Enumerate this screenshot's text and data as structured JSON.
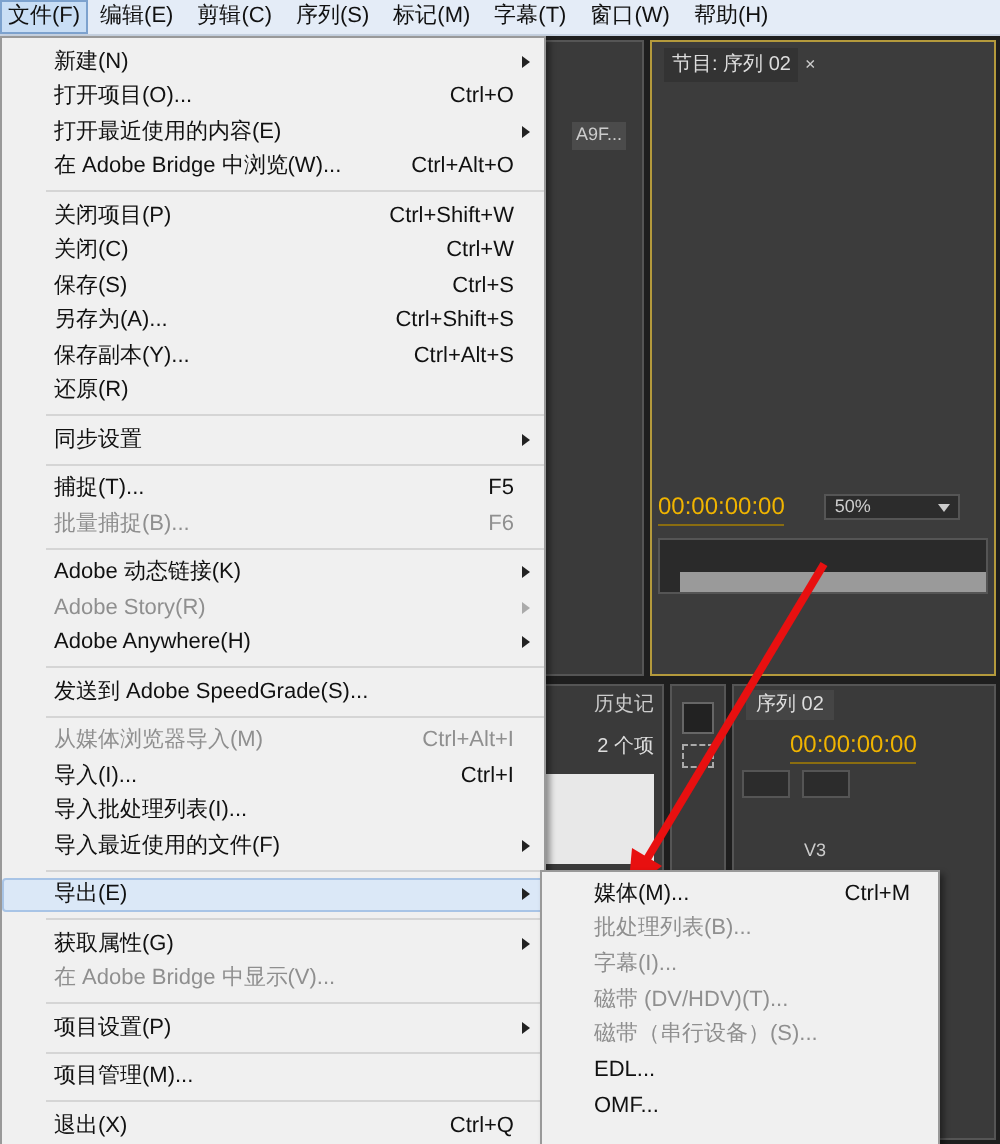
{
  "menubar": [
    {
      "label": "文件(F)",
      "selected": true
    },
    {
      "label": "编辑(E)",
      "selected": false
    },
    {
      "label": "剪辑(C)",
      "selected": false
    },
    {
      "label": "序列(S)",
      "selected": false
    },
    {
      "label": "标记(M)",
      "selected": false
    },
    {
      "label": "字幕(T)",
      "selected": false
    },
    {
      "label": "窗口(W)",
      "selected": false
    },
    {
      "label": "帮助(H)",
      "selected": false
    }
  ],
  "file_menu": [
    {
      "kind": "item",
      "label": "新建(N)",
      "submenu": true,
      "disabled": false,
      "highlighted": false
    },
    {
      "kind": "item",
      "label": "打开项目(O)...",
      "shortcut": "Ctrl+O",
      "disabled": false,
      "highlighted": false
    },
    {
      "kind": "item",
      "label": "打开最近使用的内容(E)",
      "submenu": true,
      "disabled": false,
      "highlighted": false
    },
    {
      "kind": "item",
      "label": "在 Adobe Bridge 中浏览(W)...",
      "shortcut": "Ctrl+Alt+O",
      "disabled": false,
      "highlighted": false
    },
    {
      "kind": "separator"
    },
    {
      "kind": "item",
      "label": "关闭项目(P)",
      "shortcut": "Ctrl+Shift+W",
      "disabled": false,
      "highlighted": false
    },
    {
      "kind": "item",
      "label": "关闭(C)",
      "shortcut": "Ctrl+W",
      "disabled": false,
      "highlighted": false
    },
    {
      "kind": "item",
      "label": "保存(S)",
      "shortcut": "Ctrl+S",
      "disabled": false,
      "highlighted": false
    },
    {
      "kind": "item",
      "label": "另存为(A)...",
      "shortcut": "Ctrl+Shift+S",
      "disabled": false,
      "highlighted": false
    },
    {
      "kind": "item",
      "label": "保存副本(Y)...",
      "shortcut": "Ctrl+Alt+S",
      "disabled": false,
      "highlighted": false
    },
    {
      "kind": "item",
      "label": "还原(R)",
      "disabled": false,
      "highlighted": false
    },
    {
      "kind": "separator"
    },
    {
      "kind": "item",
      "label": "同步设置",
      "submenu": true,
      "disabled": false,
      "highlighted": false
    },
    {
      "kind": "separator"
    },
    {
      "kind": "item",
      "label": "捕捉(T)...",
      "shortcut": "F5",
      "disabled": false,
      "highlighted": false
    },
    {
      "kind": "item",
      "label": "批量捕捉(B)...",
      "shortcut": "F6",
      "disabled": true,
      "highlighted": false
    },
    {
      "kind": "separator"
    },
    {
      "kind": "item",
      "label": "Adobe 动态链接(K)",
      "submenu": true,
      "disabled": false,
      "highlighted": false
    },
    {
      "kind": "item",
      "label": "Adobe Story(R)",
      "submenu": true,
      "disabled": true,
      "highlighted": false
    },
    {
      "kind": "item",
      "label": "Adobe Anywhere(H)",
      "submenu": true,
      "disabled": false,
      "highlighted": false
    },
    {
      "kind": "separator"
    },
    {
      "kind": "item",
      "label": "发送到 Adobe SpeedGrade(S)...",
      "disabled": false,
      "highlighted": false
    },
    {
      "kind": "separator"
    },
    {
      "kind": "item",
      "label": "从媒体浏览器导入(M)",
      "shortcut": "Ctrl+Alt+I",
      "disabled": true,
      "highlighted": false
    },
    {
      "kind": "item",
      "label": "导入(I)...",
      "shortcut": "Ctrl+I",
      "disabled": false,
      "highlighted": false
    },
    {
      "kind": "item",
      "label": "导入批处理列表(I)...",
      "disabled": false,
      "highlighted": false
    },
    {
      "kind": "item",
      "label": "导入最近使用的文件(F)",
      "submenu": true,
      "disabled": false,
      "highlighted": false
    },
    {
      "kind": "separator"
    },
    {
      "kind": "item",
      "label": "导出(E)",
      "submenu": true,
      "disabled": false,
      "highlighted": true
    },
    {
      "kind": "separator"
    },
    {
      "kind": "item",
      "label": "获取属性(G)",
      "submenu": true,
      "disabled": false,
      "highlighted": false
    },
    {
      "kind": "item",
      "label": "在 Adobe Bridge 中显示(V)...",
      "disabled": true,
      "highlighted": false
    },
    {
      "kind": "separator"
    },
    {
      "kind": "item",
      "label": "项目设置(P)",
      "submenu": true,
      "disabled": false,
      "highlighted": false
    },
    {
      "kind": "separator"
    },
    {
      "kind": "item",
      "label": "项目管理(M)...",
      "disabled": false,
      "highlighted": false
    },
    {
      "kind": "separator"
    },
    {
      "kind": "item",
      "label": "退出(X)",
      "shortcut": "Ctrl+Q",
      "disabled": false,
      "highlighted": false
    }
  ],
  "export_submenu": [
    {
      "label": "媒体(M)...",
      "shortcut": "Ctrl+M",
      "disabled": false
    },
    {
      "label": "批处理列表(B)...",
      "disabled": true
    },
    {
      "label": "字幕(I)...",
      "disabled": true
    },
    {
      "label": "磁带 (DV/HDV)(T)...",
      "disabled": true
    },
    {
      "label": "磁带（串行设备）(S)...",
      "disabled": true
    },
    {
      "label": "EDL...",
      "disabled": false
    },
    {
      "label": "OMF...",
      "disabled": false
    }
  ],
  "workspace": {
    "project_clip": "A9F...",
    "program_tab": "节目: 序列 02",
    "program_close": "×",
    "program_timecode": "00:00:00:00",
    "zoom": "50%",
    "history_tab": "历史记",
    "item_count": "2 个项",
    "sequence_tab": "序列 02",
    "sequence_timecode": "00:00:00:00",
    "track": "V3"
  }
}
